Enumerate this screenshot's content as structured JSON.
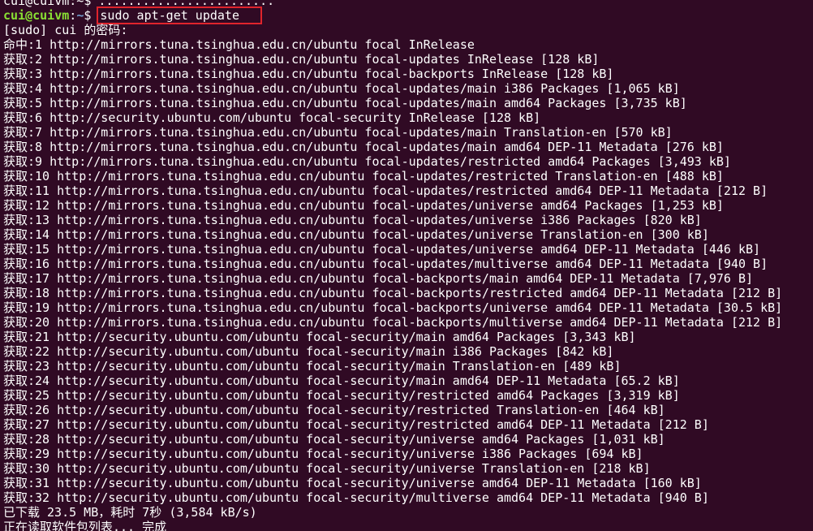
{
  "colors": {
    "background": "#300a24",
    "text": "#ffffff",
    "prompt_user": "#8ae234",
    "prompt_path": "#729fcf",
    "highlight_box": "#e0242c"
  },
  "terminal": {
    "clipped_line": "cui@cuivm:~$ ........................",
    "prompt": {
      "user_host": "cui@cuivm",
      "separator": ":",
      "path": "~",
      "symbol": "$ "
    },
    "command": "sudo apt-get update",
    "lines": [
      "[sudo] cui 的密码:",
      "命中:1 http://mirrors.tuna.tsinghua.edu.cn/ubuntu focal InRelease",
      "获取:2 http://mirrors.tuna.tsinghua.edu.cn/ubuntu focal-updates InRelease [128 kB]",
      "获取:3 http://mirrors.tuna.tsinghua.edu.cn/ubuntu focal-backports InRelease [128 kB]",
      "获取:4 http://mirrors.tuna.tsinghua.edu.cn/ubuntu focal-updates/main i386 Packages [1,065 kB]",
      "获取:5 http://mirrors.tuna.tsinghua.edu.cn/ubuntu focal-updates/main amd64 Packages [3,735 kB]",
      "获取:6 http://security.ubuntu.com/ubuntu focal-security InRelease [128 kB]",
      "获取:7 http://mirrors.tuna.tsinghua.edu.cn/ubuntu focal-updates/main Translation-en [570 kB]",
      "获取:8 http://mirrors.tuna.tsinghua.edu.cn/ubuntu focal-updates/main amd64 DEP-11 Metadata [276 kB]",
      "获取:9 http://mirrors.tuna.tsinghua.edu.cn/ubuntu focal-updates/restricted amd64 Packages [3,493 kB]",
      "获取:10 http://mirrors.tuna.tsinghua.edu.cn/ubuntu focal-updates/restricted Translation-en [488 kB]",
      "获取:11 http://mirrors.tuna.tsinghua.edu.cn/ubuntu focal-updates/restricted amd64 DEP-11 Metadata [212 B]",
      "获取:12 http://mirrors.tuna.tsinghua.edu.cn/ubuntu focal-updates/universe amd64 Packages [1,253 kB]",
      "获取:13 http://mirrors.tuna.tsinghua.edu.cn/ubuntu focal-updates/universe i386 Packages [820 kB]",
      "获取:14 http://mirrors.tuna.tsinghua.edu.cn/ubuntu focal-updates/universe Translation-en [300 kB]",
      "获取:15 http://mirrors.tuna.tsinghua.edu.cn/ubuntu focal-updates/universe amd64 DEP-11 Metadata [446 kB]",
      "获取:16 http://mirrors.tuna.tsinghua.edu.cn/ubuntu focal-updates/multiverse amd64 DEP-11 Metadata [940 B]",
      "获取:17 http://mirrors.tuna.tsinghua.edu.cn/ubuntu focal-backports/main amd64 DEP-11 Metadata [7,976 B]",
      "获取:18 http://mirrors.tuna.tsinghua.edu.cn/ubuntu focal-backports/restricted amd64 DEP-11 Metadata [212 B]",
      "获取:19 http://mirrors.tuna.tsinghua.edu.cn/ubuntu focal-backports/universe amd64 DEP-11 Metadata [30.5 kB]",
      "获取:20 http://mirrors.tuna.tsinghua.edu.cn/ubuntu focal-backports/multiverse amd64 DEP-11 Metadata [212 B]",
      "获取:21 http://security.ubuntu.com/ubuntu focal-security/main amd64 Packages [3,343 kB]",
      "获取:22 http://security.ubuntu.com/ubuntu focal-security/main i386 Packages [842 kB]",
      "获取:23 http://security.ubuntu.com/ubuntu focal-security/main Translation-en [489 kB]",
      "获取:24 http://security.ubuntu.com/ubuntu focal-security/main amd64 DEP-11 Metadata [65.2 kB]",
      "获取:25 http://security.ubuntu.com/ubuntu focal-security/restricted amd64 Packages [3,319 kB]",
      "获取:26 http://security.ubuntu.com/ubuntu focal-security/restricted Translation-en [464 kB]",
      "获取:27 http://security.ubuntu.com/ubuntu focal-security/restricted amd64 DEP-11 Metadata [212 B]",
      "获取:28 http://security.ubuntu.com/ubuntu focal-security/universe amd64 Packages [1,031 kB]",
      "获取:29 http://security.ubuntu.com/ubuntu focal-security/universe i386 Packages [694 kB]",
      "获取:30 http://security.ubuntu.com/ubuntu focal-security/universe Translation-en [218 kB]",
      "获取:31 http://security.ubuntu.com/ubuntu focal-security/universe amd64 DEP-11 Metadata [160 kB]",
      "获取:32 http://security.ubuntu.com/ubuntu focal-security/multiverse amd64 DEP-11 Metadata [940 B]",
      "已下载 23.5 MB，耗时 7秒 (3,584 kB/s)",
      "正在读取软件包列表... 完成"
    ]
  }
}
